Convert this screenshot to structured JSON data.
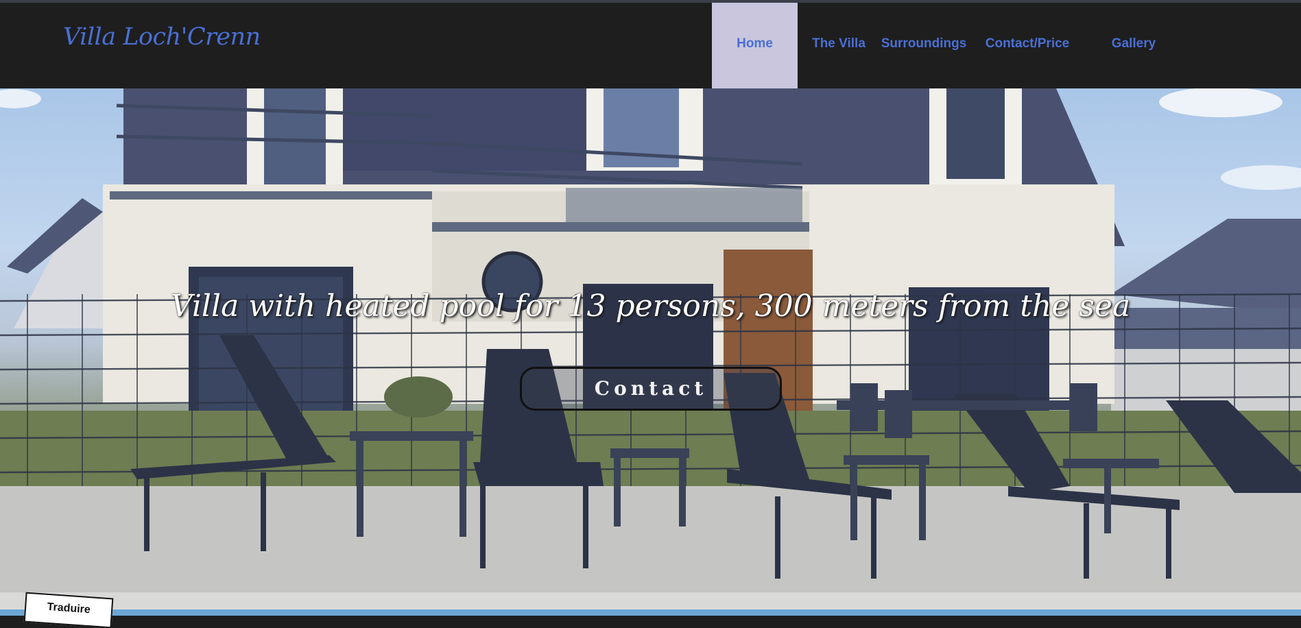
{
  "header": {
    "logo": "Villa Loch'Crenn",
    "nav": [
      {
        "label": "Home",
        "active": true
      },
      {
        "label": "The Villa",
        "active": false
      },
      {
        "label": "Surroundings",
        "active": false
      },
      {
        "label": "Contact/Price",
        "active": false
      },
      {
        "label": "Gallery",
        "active": false
      }
    ]
  },
  "hero": {
    "tagline": "Villa with heated pool for 13 persons, 300 meters from the sea",
    "button_label": "Contact",
    "image": "villa-with-pool-and-loungers"
  },
  "translate_widget": {
    "label": "Traduire"
  },
  "colors": {
    "header_bg": "#1e1e1e",
    "nav_text": "#4a6fd4",
    "active_tab_bg": "#c9c6de"
  }
}
